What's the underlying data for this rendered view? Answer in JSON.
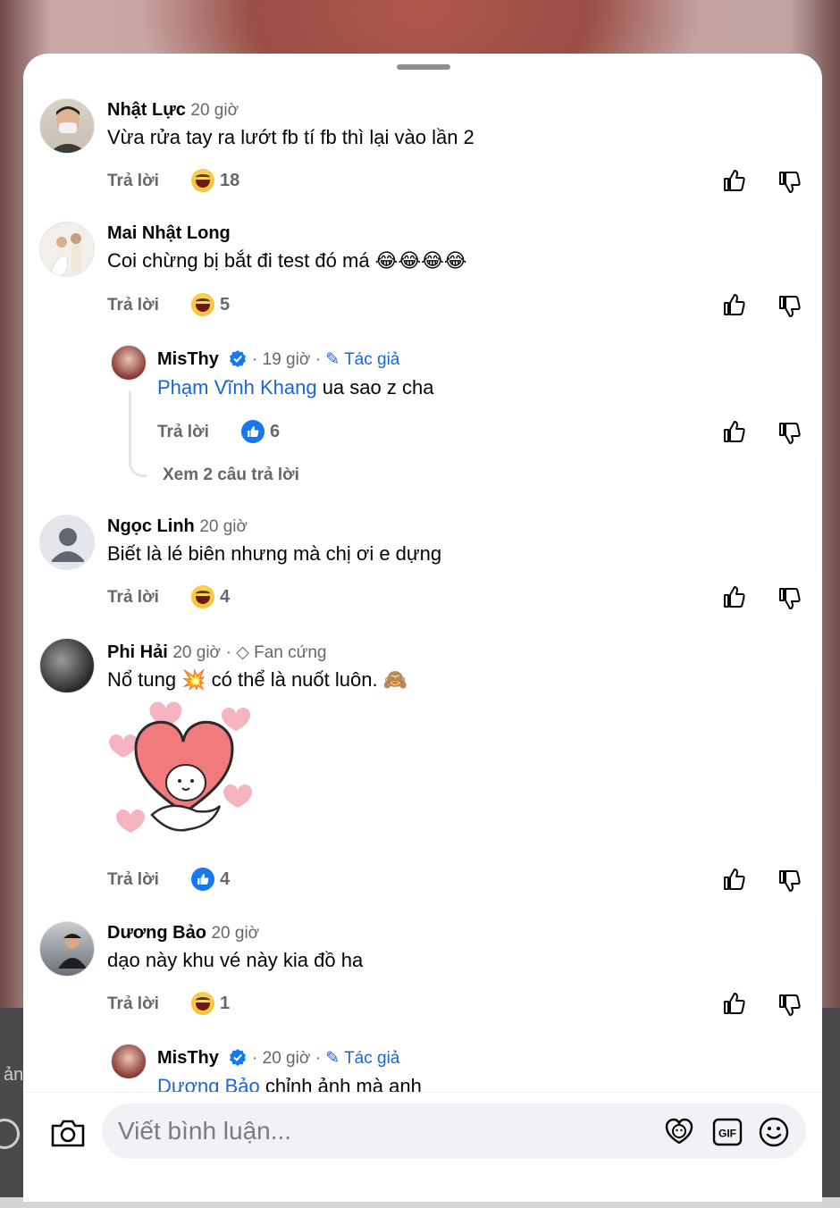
{
  "background": {
    "edge_text": "ản"
  },
  "comments": [
    {
      "name": "Nhật Lực",
      "time": "20 giờ",
      "text": "Vừa rửa tay ra lướt fb tí fb thì lại vào lần 2",
      "reply_label": "Trả lời",
      "reaction": "haha",
      "reaction_count": "18"
    },
    {
      "name": "Mai Nhật Long",
      "time": "",
      "text": "Coi chừng bị bắt đi test đó má 😂😂😂😂",
      "reply_label": "Trả lời",
      "reaction": "haha",
      "reaction_count": "5",
      "reply": {
        "name": "MisThy",
        "time": "19 giờ",
        "author_label": "Tác giả",
        "mention": "Phạm Vĩnh Khang",
        "text": " ua sao z cha",
        "reply_label": "Trả lời",
        "reaction": "like",
        "reaction_count": "6",
        "view_more": "Xem 2 câu trả lời"
      }
    },
    {
      "name": "Ngọc Linh",
      "time": "20 giờ",
      "text": "Biết là lé biên nhưng mà chị ơi e dựng",
      "reply_label": "Trả lời",
      "reaction": "haha",
      "reaction_count": "4"
    },
    {
      "name": "Phi Hải",
      "time": "20 giờ",
      "badge": "Fan cứng",
      "text": "Nổ tung 💥 có thể là nuốt luôn. 🙈",
      "sticker": "heart-hug-sticker",
      "reply_label": "Trả lời",
      "reaction": "like",
      "reaction_count": "4"
    },
    {
      "name": "Dương Bảo",
      "time": "20 giờ",
      "text": "dạo này khu vé này kia đồ ha",
      "reply_label": "Trả lời",
      "reaction": "haha",
      "reaction_count": "1",
      "reply": {
        "name": "MisThy",
        "time": "20 giờ",
        "author_label": "Tác giả",
        "mention": "Dương Bảo",
        "text": " chỉnh ảnh mà anh"
      }
    }
  ],
  "composer": {
    "placeholder": "Viết bình luận...",
    "icons": [
      "camera-icon",
      "avatar-sticker-icon",
      "gif-icon",
      "emoji-icon"
    ]
  },
  "colors": {
    "link_blue": "#1b65d6",
    "meta_gray": "#65676b",
    "like_blue": "#1877f2"
  }
}
